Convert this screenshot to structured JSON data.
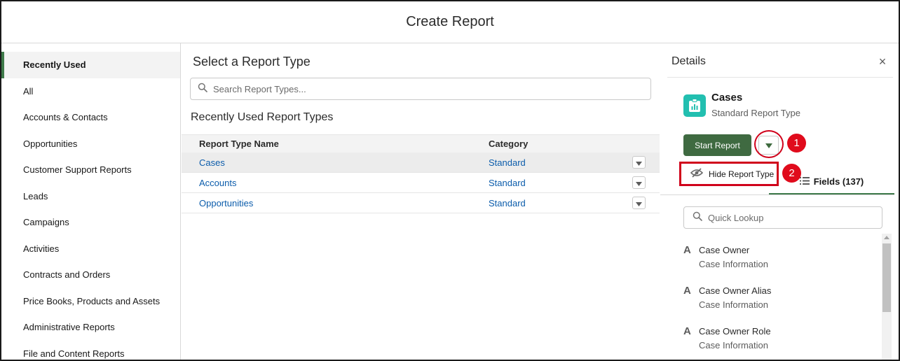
{
  "header": {
    "title": "Create Report"
  },
  "sidebar": {
    "items": [
      {
        "label": "Recently Used"
      },
      {
        "label": "All"
      },
      {
        "label": "Accounts & Contacts"
      },
      {
        "label": "Opportunities"
      },
      {
        "label": "Customer Support Reports"
      },
      {
        "label": "Leads"
      },
      {
        "label": "Campaigns"
      },
      {
        "label": "Activities"
      },
      {
        "label": "Contracts and Orders"
      },
      {
        "label": "Price Books, Products and Assets"
      },
      {
        "label": "Administrative Reports"
      },
      {
        "label": "File and Content Reports"
      }
    ]
  },
  "main": {
    "title": "Select a Report Type",
    "search_placeholder": "Search Report Types...",
    "section_label": "Recently Used Report Types",
    "columns": [
      "Report Type Name",
      "Category"
    ],
    "rows": [
      {
        "name": "Cases",
        "category": "Standard"
      },
      {
        "name": "Accounts",
        "category": "Standard"
      },
      {
        "name": "Opportunities",
        "category": "Standard"
      }
    ]
  },
  "details": {
    "title": "Details",
    "close_label": "×",
    "object_name": "Cases",
    "object_type": "Standard Report Type",
    "start_button": "Start Report",
    "hide_menu_item": "Hide Report Type",
    "fields_tab": "Fields (137)",
    "lookup_placeholder": "Quick Lookup",
    "fields": [
      {
        "name": "Case Owner",
        "group": "Case Information"
      },
      {
        "name": "Case Owner Alias",
        "group": "Case Information"
      },
      {
        "name": "Case Owner Role",
        "group": "Case Information"
      }
    ],
    "annotation_1": "1",
    "annotation_2": "2"
  },
  "colors": {
    "accent_green": "#3e7a4a",
    "button_green": "#3f6a41",
    "link_blue": "#0b5cab",
    "annotation_red": "#d0021b",
    "object_icon_teal": "#22bfb0"
  },
  "icons": [
    "search-icon",
    "chevron-down-icon",
    "close-icon",
    "report-object-icon",
    "eye-slash-icon",
    "list-icon",
    "text-field-icon"
  ]
}
